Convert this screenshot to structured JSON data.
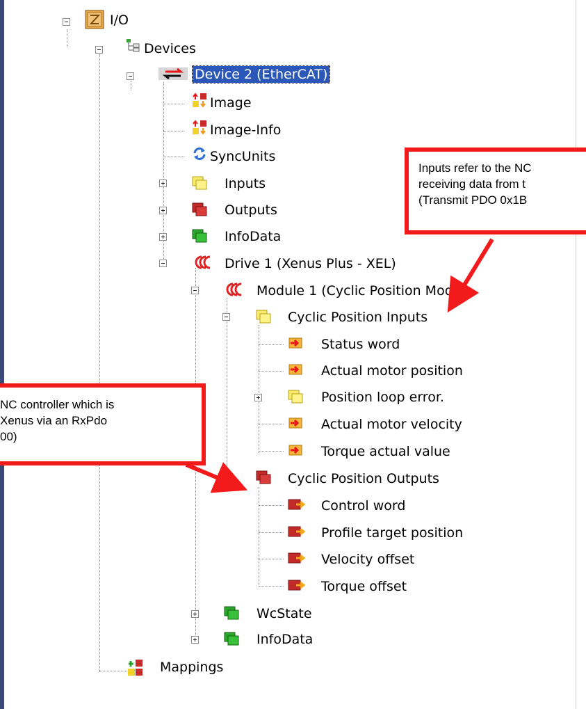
{
  "tree": {
    "root": "I/O",
    "devices": "Devices",
    "device2": "Device 2 (EtherCAT)",
    "image": "Image",
    "image_info": "Image-Info",
    "sync_units": "SyncUnits",
    "inputs": "Inputs",
    "outputs": "Outputs",
    "infodata": "InfoData",
    "drive1": "Drive 1 (Xenus Plus - XEL)",
    "module1": "Module 1 (Cyclic Position Mode)",
    "cyclic_inputs": "Cyclic Position Inputs",
    "status_word": "Status word",
    "actual_motor_position": "Actual motor position",
    "position_loop_error": "Position loop error.",
    "actual_motor_velocity": "Actual motor velocity",
    "torque_actual_value": "Torque actual value",
    "cyclic_outputs": "Cyclic Position Outputs",
    "control_word": "Control word",
    "profile_target_position": "Profile target position",
    "velocity_offset": "Velocity offset",
    "torque_offset": "Torque offset",
    "wcstate": "WcState",
    "infodata2": "InfoData",
    "mappings": "Mappings"
  },
  "callouts": {
    "right": [
      "Inputs refer to the NC",
      "receiving data from t",
      "(Transmit PDO 0x1B"
    ],
    "left": [
      "NC controller which is",
      "Xenus via an RxPdo",
      "00)"
    ]
  },
  "colors": {
    "selection": "#2a57b8",
    "callout_border": "#f21a1a",
    "arrow": "#f21a1a"
  }
}
